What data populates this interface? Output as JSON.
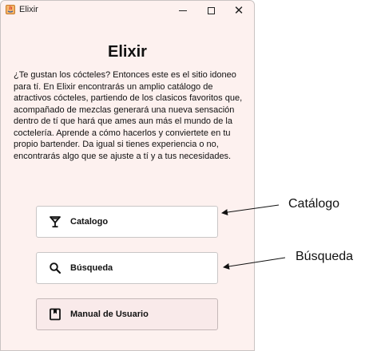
{
  "window": {
    "title": "Elixir",
    "controls": [
      "minimize-icon",
      "maximize-icon",
      "close-icon"
    ]
  },
  "main": {
    "heading": "Elixir",
    "description": "¿Te gustan los cócteles? Entonces este es el sitio idoneo para tí. En Elixir encontrarás un amplio catálogo de atractivos cócteles, partiendo de los clasicos favoritos que, acompañado de mezclas generará una nueva sensación dentro de tí que hará que ames aun más el mundo de la coctelería. Aprende a cómo hacerlos y conviertete en tu propio bartender. Da igual si tienes experiencia o no, encontrarás algo que se ajuste a tí y a tus necesidades."
  },
  "buttons": [
    {
      "label": "Catalogo",
      "icon": "cocktail-glass-icon"
    },
    {
      "label": "Búsqueda",
      "icon": "search-icon"
    },
    {
      "label": "Manual de Usuario",
      "icon": "book-icon"
    }
  ],
  "annotations": [
    {
      "text": "Catálogo",
      "target": "Catalogo"
    },
    {
      "text": "Búsqueda",
      "target": "Búsqueda"
    }
  ]
}
